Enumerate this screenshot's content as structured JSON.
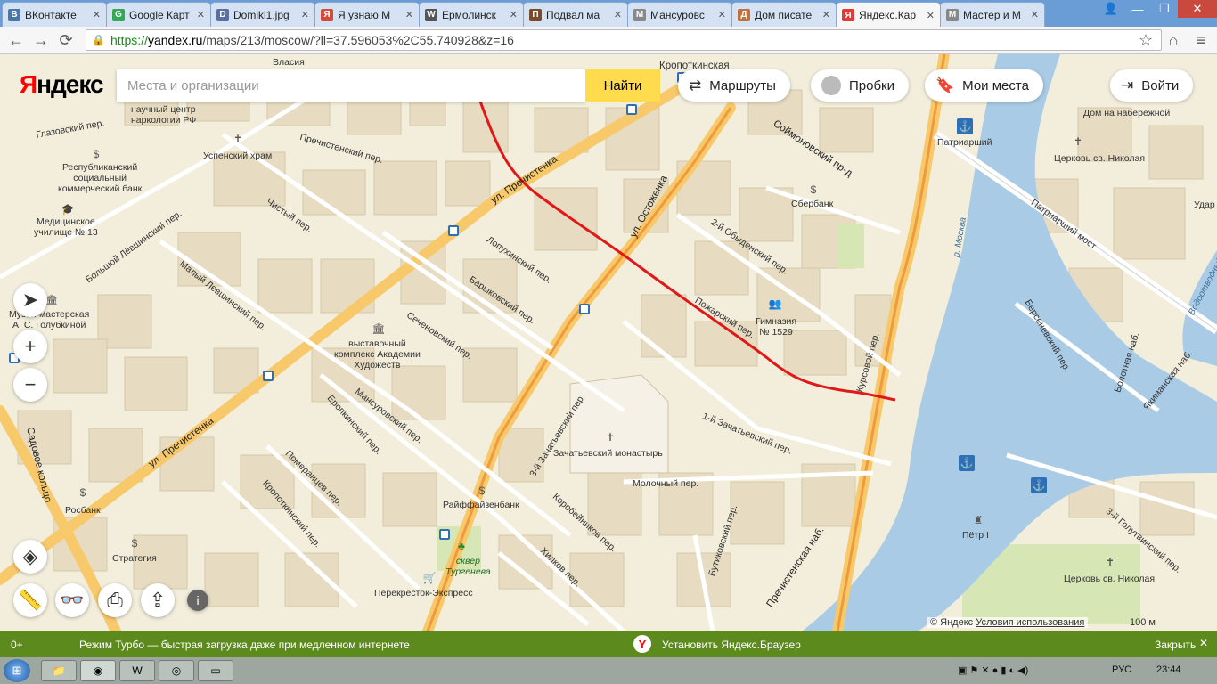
{
  "browser": {
    "tabs": [
      {
        "label": "ВКонтакте",
        "color": "#4a76a8",
        "glyph": "В"
      },
      {
        "label": "Google Карт",
        "color": "#34a853",
        "glyph": "G"
      },
      {
        "label": "Domiki1.jpg",
        "color": "#5a6fa0",
        "glyph": "D"
      },
      {
        "label": "Я узнаю М",
        "color": "#d44a3a",
        "glyph": "Я"
      },
      {
        "label": "Ермолинск",
        "color": "#555555",
        "glyph": "W"
      },
      {
        "label": "Подвал ма",
        "color": "#7a4a2a",
        "glyph": "П"
      },
      {
        "label": "Мансуровс",
        "color": "#888888",
        "glyph": "М"
      },
      {
        "label": "Дом писате",
        "color": "#c0703a",
        "glyph": "Д"
      },
      {
        "label": "Яндекс.Кар",
        "color": "#e53935",
        "glyph": "Я"
      },
      {
        "label": "Мастер и М",
        "color": "#888888",
        "glyph": "М"
      }
    ],
    "url_secure": "https://",
    "url_host": "yandex.ru",
    "url_path": "/maps/213/moscow/?ll=37.596053%2C55.740928&z=16"
  },
  "yandex": {
    "logo_red": "Я",
    "logo_rest": "ндекс",
    "search_placeholder": "Места и организации",
    "find_label": "Найти",
    "routes_label": "Маршруты",
    "traffic_label": "Пробки",
    "myplaces_label": "Мои места",
    "login_label": "Войти"
  },
  "map": {
    "streets": {
      "prechistenka": "ул. Пречистенка",
      "prechistenka2": "ул. Пречистенка",
      "ostozhenka": "ул. Остоженка",
      "lopukhinsky": "Лопухинский пер.",
      "barykovsky": "Барыковский пер.",
      "sechenovsky": "Сеченовский пер.",
      "mansurovsky": "Мансуровский пер.",
      "eropkinsky": "Еропкинский пер.",
      "pomerantsev": "Померанцев пер.",
      "kropotkinsky": "Кропоткинский пер.",
      "korobeinikov": "Коробейников пер.",
      "khilkov": "Хилков пер.",
      "butikovsky": "Бутиковский пер.",
      "molochny": "Молочный пер.",
      "zachatievsky1": "1-й Зачатьевский пер.",
      "zachatievsky3": "3-й Зачатьевский пер.",
      "pozharsky": "Пожарский пер.",
      "kursovoy": "Курсовой пер.",
      "obydensky": "2-й Обыденский пер.",
      "soymonovsky": "Соймоновский пр-д",
      "chisty": "Чистый пер.",
      "prechistensky": "Пречистенский пер.",
      "malyLevshinsky": "Малый Левшинский пер.",
      "bolshoyLevshinsky": "Большой Лёвшинский пер.",
      "glazovsky": "Глазовский пер.",
      "vlasia": "Власия",
      "prechEmb": "Пречистенская наб.",
      "bersenevsky": "Берсеневский пер.",
      "bolotnaya": "Болотная наб.",
      "yakimanskaya": "Якиманская наб.",
      "golutvinsky": "3-й Голутвинский пер.",
      "patriarshy": "Патриарший мост",
      "sadovoe": "Садовое кольцо",
      "moskva": "р. Москва",
      "vodootvodny": "Водоотводный"
    },
    "places": {
      "kropotkinskaya": "Кропоткинская",
      "patriarshy": "Патриарший",
      "dom_nab": "Дом на набережной",
      "church_nikolaya": "Церковь св. Николая",
      "church_nikolaya2": "Церковь св. Николая",
      "uspensky": "Успенский храм",
      "sberbank": "Сбербанк",
      "gymnasium": "Гимназия\n№ 1529",
      "monastery": "Зачатьевский монастырь",
      "raiffeisen": "Райффайзенбанк",
      "skver": "сквер\nТургенева",
      "perekrestok": "Перекрёсток-Экспресс",
      "rosbank": "Росбанк",
      "strategiya": "Стратегия",
      "medschool": "Медицинское\nучилище № 13",
      "repbank": "Республиканский\nсоциальный\nкоммерческий банк",
      "narcology": "научный центр\nнаркологии РФ",
      "golubkina": "Музей-мастерская\nА. С. Голубкиной",
      "academy": "выставочный\nкомплекс Академии\nХудожеств",
      "petr": "Пётр I",
      "udar": "Удар"
    },
    "copyright": "© Яндекс",
    "terms": "Условия использования",
    "scale": "100 м"
  },
  "turbo": {
    "left": "0+",
    "message": "Режим Турбо — быстрая загрузка даже при медленном интернете",
    "install": "Установить Яндекс.Браузер",
    "close": "Закрыть"
  },
  "taskbar": {
    "lang": "РУС",
    "time": "23:44"
  },
  "colors": {
    "route": "#e01818",
    "water": "#a9cbe6",
    "major_road": "#f7c96b",
    "turbo_bar": "#5c8a1c"
  }
}
